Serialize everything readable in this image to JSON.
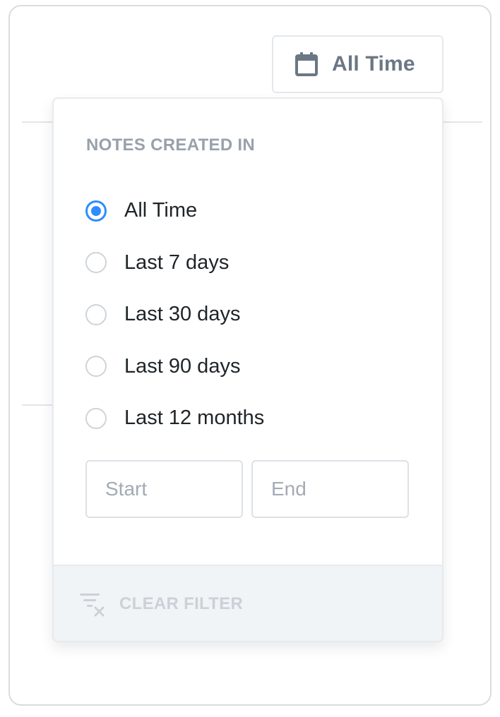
{
  "toolbar": {
    "date_filter_label": "All Time",
    "date_filter_icon": "calendar-icon"
  },
  "dropdown": {
    "title": "NOTES CREATED IN",
    "selected_index": 0,
    "options": [
      {
        "label": "All Time",
        "checked": true
      },
      {
        "label": "Last 7 days",
        "checked": false
      },
      {
        "label": "Last 30 days",
        "checked": false
      },
      {
        "label": "Last 90 days",
        "checked": false
      },
      {
        "label": "Last 12 months",
        "checked": false
      }
    ],
    "start": {
      "value": "",
      "placeholder": "Start"
    },
    "end": {
      "value": "",
      "placeholder": "End"
    },
    "clear_label": "CLEAR FILTER",
    "clear_icon": "clear-filter-icon"
  },
  "colors": {
    "accent": "#2f8cff",
    "muted_text": "#98a1ab",
    "body_text": "#1f2428",
    "footer_bg": "#f1f4f7"
  }
}
